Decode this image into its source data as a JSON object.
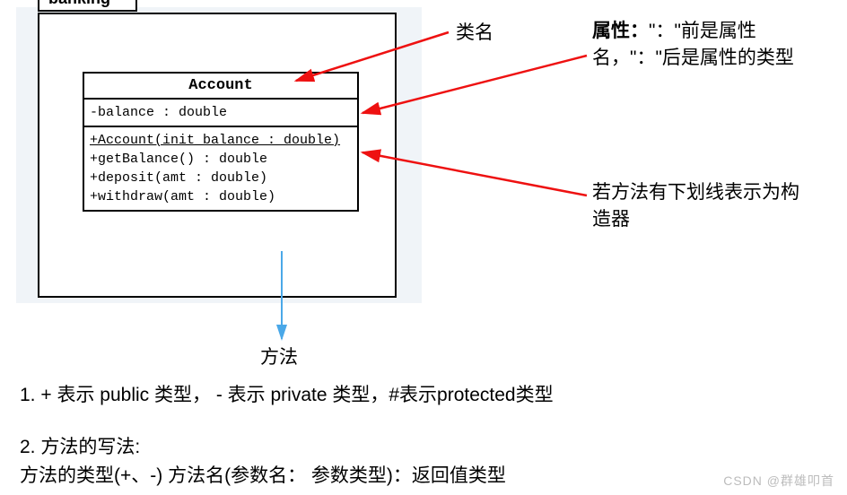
{
  "diagram": {
    "package_name": "banking",
    "class": {
      "name": "Account",
      "attributes": [
        "-balance : double"
      ],
      "methods": [
        {
          "sig": "+Account(init_balance : double)",
          "constructor": true
        },
        {
          "sig": "+getBalance() : double",
          "constructor": false
        },
        {
          "sig": "+deposit(amt : double)",
          "constructor": false
        },
        {
          "sig": "+withdraw(amt : double)",
          "constructor": false
        }
      ]
    }
  },
  "annotations": {
    "classname": "类名",
    "attribute": "属性：\"：\"前是属性名，\"：\"后是属性的类型",
    "constructor": "若方法有下划线表示为构造器",
    "method": "方法"
  },
  "explain": {
    "line1": "1. + 表示 public 类型，  - 表示 private 类型，#表示protected类型",
    "line2": "2. 方法的写法:",
    "line3": "方法的类型(+、-)  方法名(参数名：  参数类型)：返回值类型"
  },
  "watermark": "CSDN @群雄叩首"
}
